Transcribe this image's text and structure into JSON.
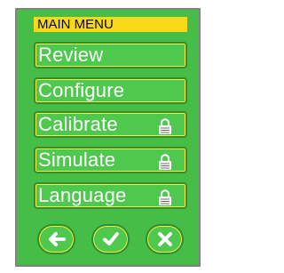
{
  "menu": {
    "title": "MAIN MENU",
    "items": [
      {
        "label": "Review",
        "locked": false
      },
      {
        "label": "Configure",
        "locked": false
      },
      {
        "label": "Calibrate",
        "locked": true
      },
      {
        "label": "Simulate",
        "locked": true
      },
      {
        "label": "Language",
        "locked": true
      }
    ]
  },
  "navigation": {
    "icons": [
      "back-arrow-icon",
      "checkmark-icon",
      "close-icon"
    ]
  },
  "colors": {
    "screen_background": "#46bd47",
    "button_fill": "#4fc84e",
    "button_outline": "#2f8d32",
    "button_highlight": "#ffef3a",
    "header_background": "#f7d81a",
    "header_text": "#0a0a0a",
    "menu_text": "#ffffff",
    "frame_border": "#7c847c"
  }
}
